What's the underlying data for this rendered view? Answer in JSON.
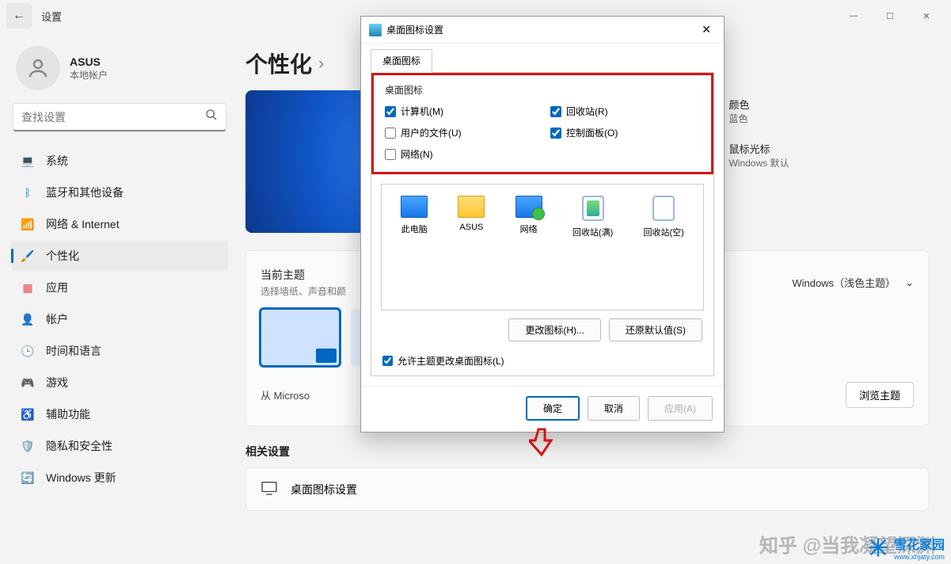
{
  "titlebar": {
    "app_title": "设置"
  },
  "user": {
    "name": "ASUS",
    "account_type": "本地帐户"
  },
  "search": {
    "placeholder": "查找设置"
  },
  "nav": {
    "items": [
      {
        "icon": "💻",
        "label": "系统"
      },
      {
        "icon": "ᛒ",
        "label": "蓝牙和其他设备",
        "color": "#0078d4"
      },
      {
        "icon": "📶",
        "label": "网络 & Internet",
        "color": "#0078d4"
      },
      {
        "icon": "🖌️",
        "label": "个性化",
        "active": true
      },
      {
        "icon": "▦",
        "label": "应用",
        "color": "#e74856"
      },
      {
        "icon": "👤",
        "label": "帐户",
        "color": "#ff8c00"
      },
      {
        "icon": "🕒",
        "label": "时间和语言"
      },
      {
        "icon": "🎮",
        "label": "游戏"
      },
      {
        "icon": "♿",
        "label": "辅助功能",
        "color": "#0078d4"
      },
      {
        "icon": "🛡️",
        "label": "隐私和安全性"
      },
      {
        "icon": "🔄",
        "label": "Windows 更新",
        "color": "#0078d4"
      }
    ]
  },
  "breadcrumb": {
    "root": "个性化",
    "arrow": "›"
  },
  "rail": {
    "color": {
      "title": "颜色",
      "sub": "蓝色"
    },
    "cursor": {
      "title": "鼠标光标",
      "sub": "Windows 默认"
    }
  },
  "theme": {
    "title": "当前主题",
    "sub": "选择墙纸、声音和颜",
    "selected": "Windows（浅色主题）",
    "store_label": "从 Microso",
    "browse": "浏览主题"
  },
  "related": {
    "title": "相关设置",
    "item": "桌面图标设置"
  },
  "dialog": {
    "title": "桌面图标设置",
    "tab": "桌面图标",
    "group_title": "桌面图标",
    "checks": {
      "computer": {
        "label": "计算机(M)",
        "checked": true
      },
      "recycle": {
        "label": "回收站(R)",
        "checked": true
      },
      "userfiles": {
        "label": "用户的文件(U)",
        "checked": false
      },
      "control": {
        "label": "控制面板(O)",
        "checked": true
      },
      "network": {
        "label": "网络(N)",
        "checked": false
      }
    },
    "icons": {
      "pc": "此电脑",
      "user": "ASUS",
      "net": "网络",
      "bin_full": "回收站(满)",
      "bin_empty": "回收站(空)"
    },
    "btn_change": "更改图标(H)...",
    "btn_restore": "还原默认值(S)",
    "allow_theme": "允许主题更改桌面图标(L)",
    "ok": "确定",
    "cancel": "取消",
    "apply": "应用(A)"
  },
  "watermark": {
    "text": "知乎 @当我凝望深渊",
    "brand": "雪花家园",
    "url": "www.xhjaty.com"
  }
}
